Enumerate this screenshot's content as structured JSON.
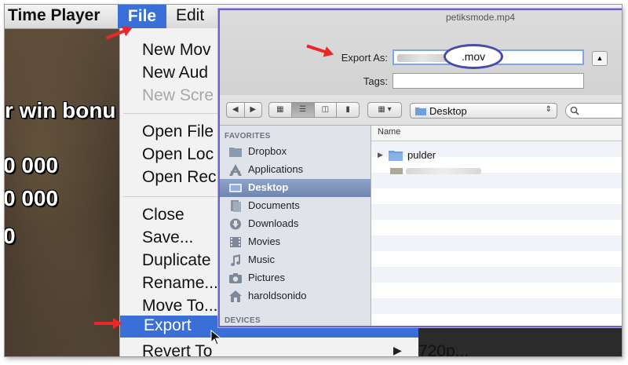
{
  "menubar": {
    "app_name": "Time Player",
    "file_label": "File",
    "edit_label": "Edit"
  },
  "video": {
    "line1": "r win bonu",
    "line2": "0 000",
    "line3": "0 000",
    "line4": "0"
  },
  "file_menu": {
    "items": [
      {
        "label": "New Mov",
        "disabled": false
      },
      {
        "label": "New Aud",
        "disabled": false
      },
      {
        "label": "New Scre",
        "disabled": true
      },
      {
        "label": "Open File",
        "disabled": false
      },
      {
        "label": "Open Loc",
        "disabled": false
      },
      {
        "label": "Open Rec",
        "disabled": false
      },
      {
        "label": "Close",
        "disabled": false
      },
      {
        "label": "Save...",
        "disabled": false
      },
      {
        "label": "Duplicate",
        "disabled": false
      },
      {
        "label": "Rename...",
        "disabled": false
      },
      {
        "label": "Move To...",
        "disabled": false
      }
    ],
    "export_label": "Export",
    "revert_label": "Revert To",
    "submenu_item": "720p..."
  },
  "sheet": {
    "window_title": "petiksmode.mp4",
    "export_as_label": "Export As:",
    "export_as_value": ".mov",
    "tags_label": "Tags:",
    "location": "Desktop",
    "column_name": "Name"
  },
  "sidebar": {
    "favorites_header": "FAVORITES",
    "devices_header": "DEVICES",
    "items": [
      {
        "label": "Dropbox",
        "icon": "dropbox-icon"
      },
      {
        "label": "Applications",
        "icon": "applications-icon"
      },
      {
        "label": "Desktop",
        "icon": "desktop-icon",
        "selected": true
      },
      {
        "label": "Documents",
        "icon": "documents-icon"
      },
      {
        "label": "Downloads",
        "icon": "downloads-icon"
      },
      {
        "label": "Movies",
        "icon": "movies-icon"
      },
      {
        "label": "Music",
        "icon": "music-icon"
      },
      {
        "label": "Pictures",
        "icon": "pictures-icon"
      },
      {
        "label": "haroldsonido",
        "icon": "home-icon"
      }
    ]
  },
  "files": [
    {
      "name": "pulder",
      "type": "folder"
    }
  ],
  "colors": {
    "menu_highlight": "#3a6fd8",
    "annotation_arrow": "#e8282a",
    "annotation_oval": "#4a4aa8",
    "sheet_border": "#6e62c8",
    "sidebar_selected": "#7a8fbb"
  }
}
